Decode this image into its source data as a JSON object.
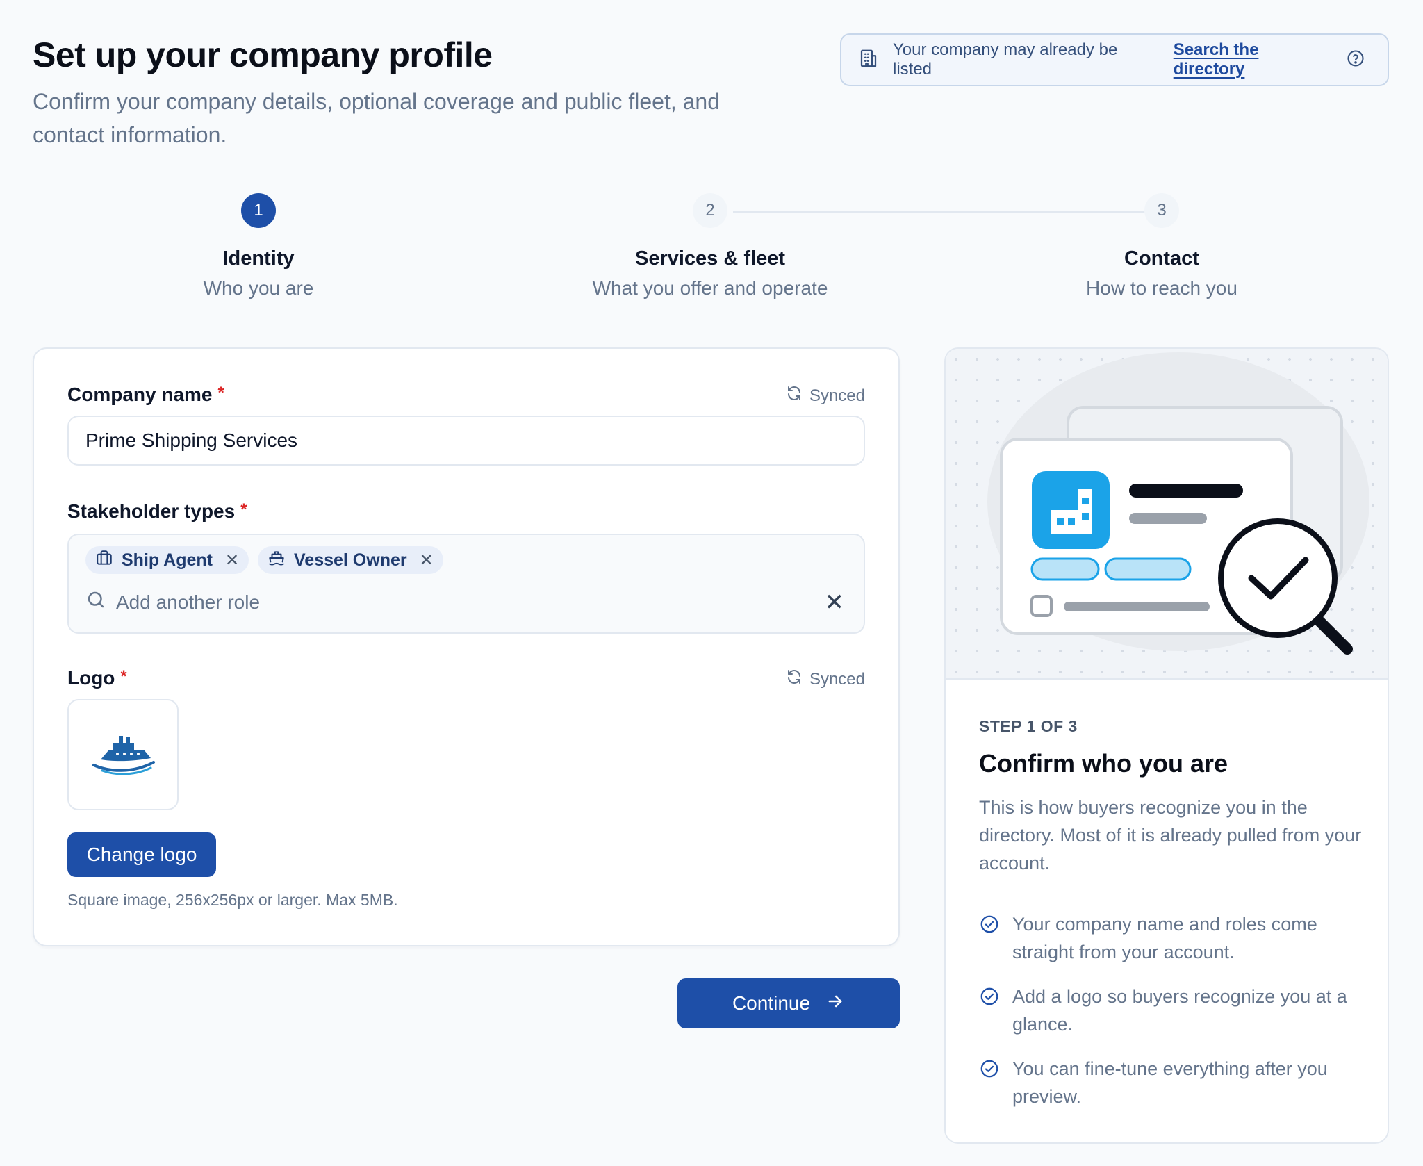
{
  "header": {
    "title": "Set up your company profile",
    "subtitle": "Confirm your company details, optional coverage and public fleet, and contact information."
  },
  "banner": {
    "text": "Your company may already be listed",
    "link": "Search the directory",
    "icon": "building-icon",
    "help_icon": "help-circle-icon"
  },
  "steps": [
    {
      "number": "1",
      "title": "Identity",
      "subtitle": "Who you are",
      "active": true
    },
    {
      "number": "2",
      "title": "Services & fleet",
      "subtitle": "What you offer and operate",
      "active": false
    },
    {
      "number": "3",
      "title": "Contact",
      "subtitle": "How to reach you",
      "active": false
    }
  ],
  "form": {
    "company_name": {
      "label": "Company name",
      "required_mark": "*",
      "status": "Synced",
      "value": "Prime Shipping Services"
    },
    "stakeholder": {
      "label": "Stakeholder types",
      "required_mark": "*",
      "chips": [
        {
          "label": "Ship Agent",
          "icon": "briefcase-icon"
        },
        {
          "label": "Vessel Owner",
          "icon": "ship-icon"
        }
      ],
      "placeholder": "Add another role"
    },
    "logo": {
      "label": "Logo",
      "required_mark": "*",
      "status": "Synced",
      "change_button": "Change logo",
      "help": "Square image, 256x256px or larger. Max 5MB."
    },
    "continue_button": "Continue"
  },
  "side": {
    "eyebrow": "STEP 1 OF 3",
    "title": "Confirm who you are",
    "description": "This is how buyers recognize you in the directory. Most of it is already pulled from your account.",
    "points": [
      "Your company name and roles come straight from your account.",
      "Add a logo so buyers recognize you at a glance.",
      "You can fine-tune everything after you preview."
    ]
  },
  "colors": {
    "primary": "#1e4fa8",
    "accent_blue": "#1ba3e8",
    "required": "#dc2626",
    "muted_text": "#64748b"
  }
}
